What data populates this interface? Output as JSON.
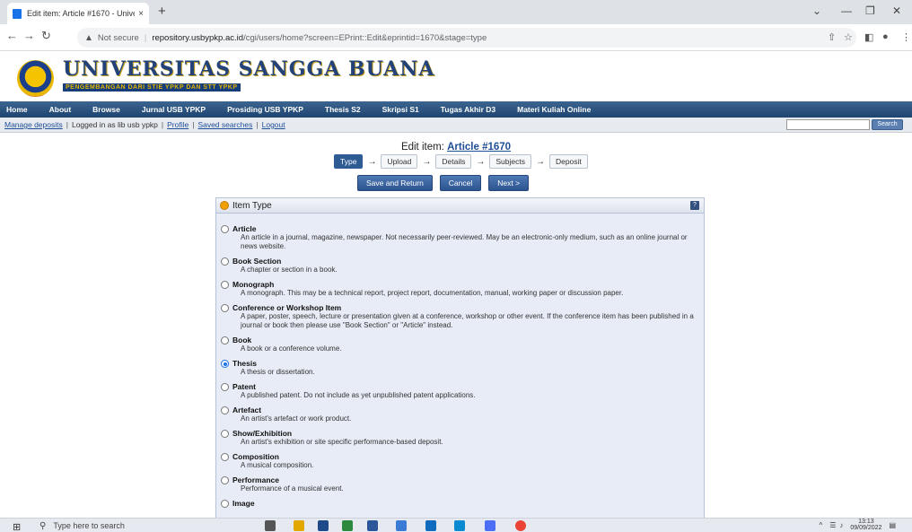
{
  "browser": {
    "tab_title": "Edit item: Article #1670 - Univers",
    "tab_close": "×",
    "new_tab": "+",
    "url_warning": "Not secure",
    "url_host": "repository.usbypkp.ac.id",
    "url_path": "/cgi/users/home?screen=EPrint::Edit&eprintid=1670&stage=type"
  },
  "site": {
    "name": "UNIVERSITAS SANGGA BUANA",
    "tagline": "PENGEMBANGAN DARI STIE YPKP DAN STT YPKP",
    "menu": [
      "Home",
      "About",
      "Browse",
      "Jurnal USB YPKP",
      "Prosiding USB YPKP",
      "Thesis S2",
      "Skripsi S1",
      "Tugas Akhir D3",
      "Materi Kuliah Online"
    ]
  },
  "userbar": {
    "manage": "Manage deposits",
    "logged": "Logged in as lib usb ypkp",
    "profile": "Profile",
    "saved": "Saved searches",
    "logout": "Logout",
    "search_btn": "Search"
  },
  "edit": {
    "title_prefix": "Edit item: ",
    "title_link": "Article #1670",
    "stages": [
      "Type",
      "Upload",
      "Details",
      "Subjects",
      "Deposit"
    ],
    "active_stage": "Type",
    "buttons": [
      "Save and Return",
      "Cancel",
      "Next >"
    ]
  },
  "panel": {
    "title": "Item Type",
    "help": "?",
    "selected": "Thesis",
    "items": [
      {
        "name": "Article",
        "desc": "An article in a journal, magazine, newspaper. Not necessarily peer-reviewed. May be an electronic-only medium, such as an online journal or news website."
      },
      {
        "name": "Book Section",
        "desc": "A chapter or section in a book."
      },
      {
        "name": "Monograph",
        "desc": "A monograph. This may be a technical report, project report, documentation, manual, working paper or discussion paper."
      },
      {
        "name": "Conference or Workshop Item",
        "desc": "A paper, poster, speech, lecture or presentation given at a conference, workshop or other event. If the conference item has been published in a journal or book then please use \"Book Section\" or \"Article\" instead."
      },
      {
        "name": "Book",
        "desc": "A book or a conference volume."
      },
      {
        "name": "Thesis",
        "desc": "A thesis or dissertation."
      },
      {
        "name": "Patent",
        "desc": "A published patent. Do not include as yet unpublished patent applications."
      },
      {
        "name": "Artefact",
        "desc": "An artist's artefact or work product."
      },
      {
        "name": "Show/Exhibition",
        "desc": "An artist's exhibition or site specific performance-based deposit."
      },
      {
        "name": "Composition",
        "desc": "A musical composition."
      },
      {
        "name": "Performance",
        "desc": "Performance of a musical event."
      },
      {
        "name": "Image",
        "desc": ""
      }
    ]
  },
  "taskbar": {
    "search_placeholder": "Type here to search",
    "time": "13:13",
    "date": "09/09/2022"
  }
}
